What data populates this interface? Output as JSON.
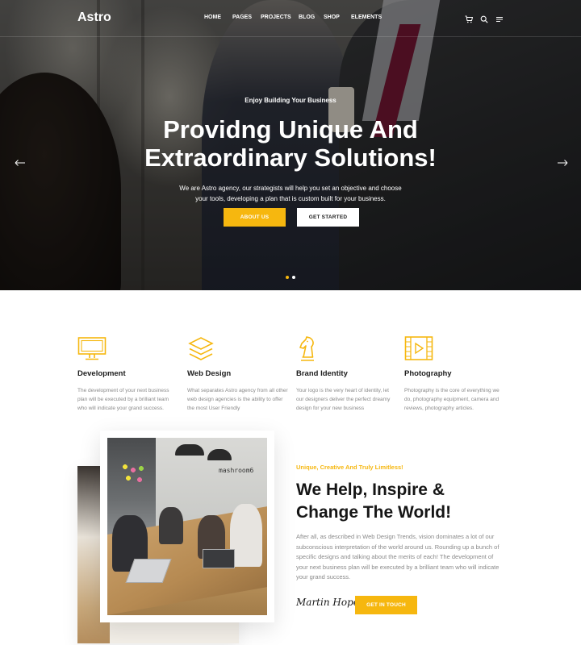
{
  "brand": {
    "logo": "Astro",
    "accent": "#f6b70f"
  },
  "nav": {
    "items": [
      "HOME",
      "PAGES",
      "PROJECTS",
      "BLOG",
      "SHOP",
      "ELEMENTS"
    ],
    "icons": [
      "cart-icon",
      "search-icon",
      "menu-icon"
    ]
  },
  "hero": {
    "kicker": "Enjoy Building Your Business",
    "title": "Providng Unique And Extraordinary Solutions!",
    "description": "We are Astro agency, our strategists will help you set an objective and choose your tools, developing a plan that is custom built for your business.",
    "buttons": {
      "primary": "ABOUT US",
      "secondary": "GET STARTED"
    },
    "slides": 2,
    "active_slide": 1
  },
  "features": [
    {
      "icon": "monitor-icon",
      "title": "Development",
      "description": "The development of your next business plan will be executed by a brilliant team who will indicate your grand success."
    },
    {
      "icon": "layers-icon",
      "title": "Web Design",
      "description": "What separates Astro agency from all other web design agencies is the ability to offer the most User Friendly"
    },
    {
      "icon": "chess-knight-icon",
      "title": "Brand Identity",
      "description": "Your logo is the very heart of identity, let our designers deliver the perfect dreamy design for your new business"
    },
    {
      "icon": "film-play-icon",
      "title": "Photography",
      "description": "Photography is the core of everything we do, photography equipment, camera and reviews, photography articles."
    }
  ],
  "about": {
    "kicker": "Unique, Creative And Truly Limitless!",
    "title": "We Help, Inspire & Change The World!",
    "description": "After all, as described in Web Design Trends, vision dominates a lot of our subconscious interpretation of the world around us. Rounding up a bunch of specific designs and talking about the merits of each! The development of your next business plan will be executed by a brilliant team who will indicate your grand success.",
    "signature": "Martin Hope",
    "button": "GET IN TOUCH",
    "photo_sign": "mashroom6"
  }
}
